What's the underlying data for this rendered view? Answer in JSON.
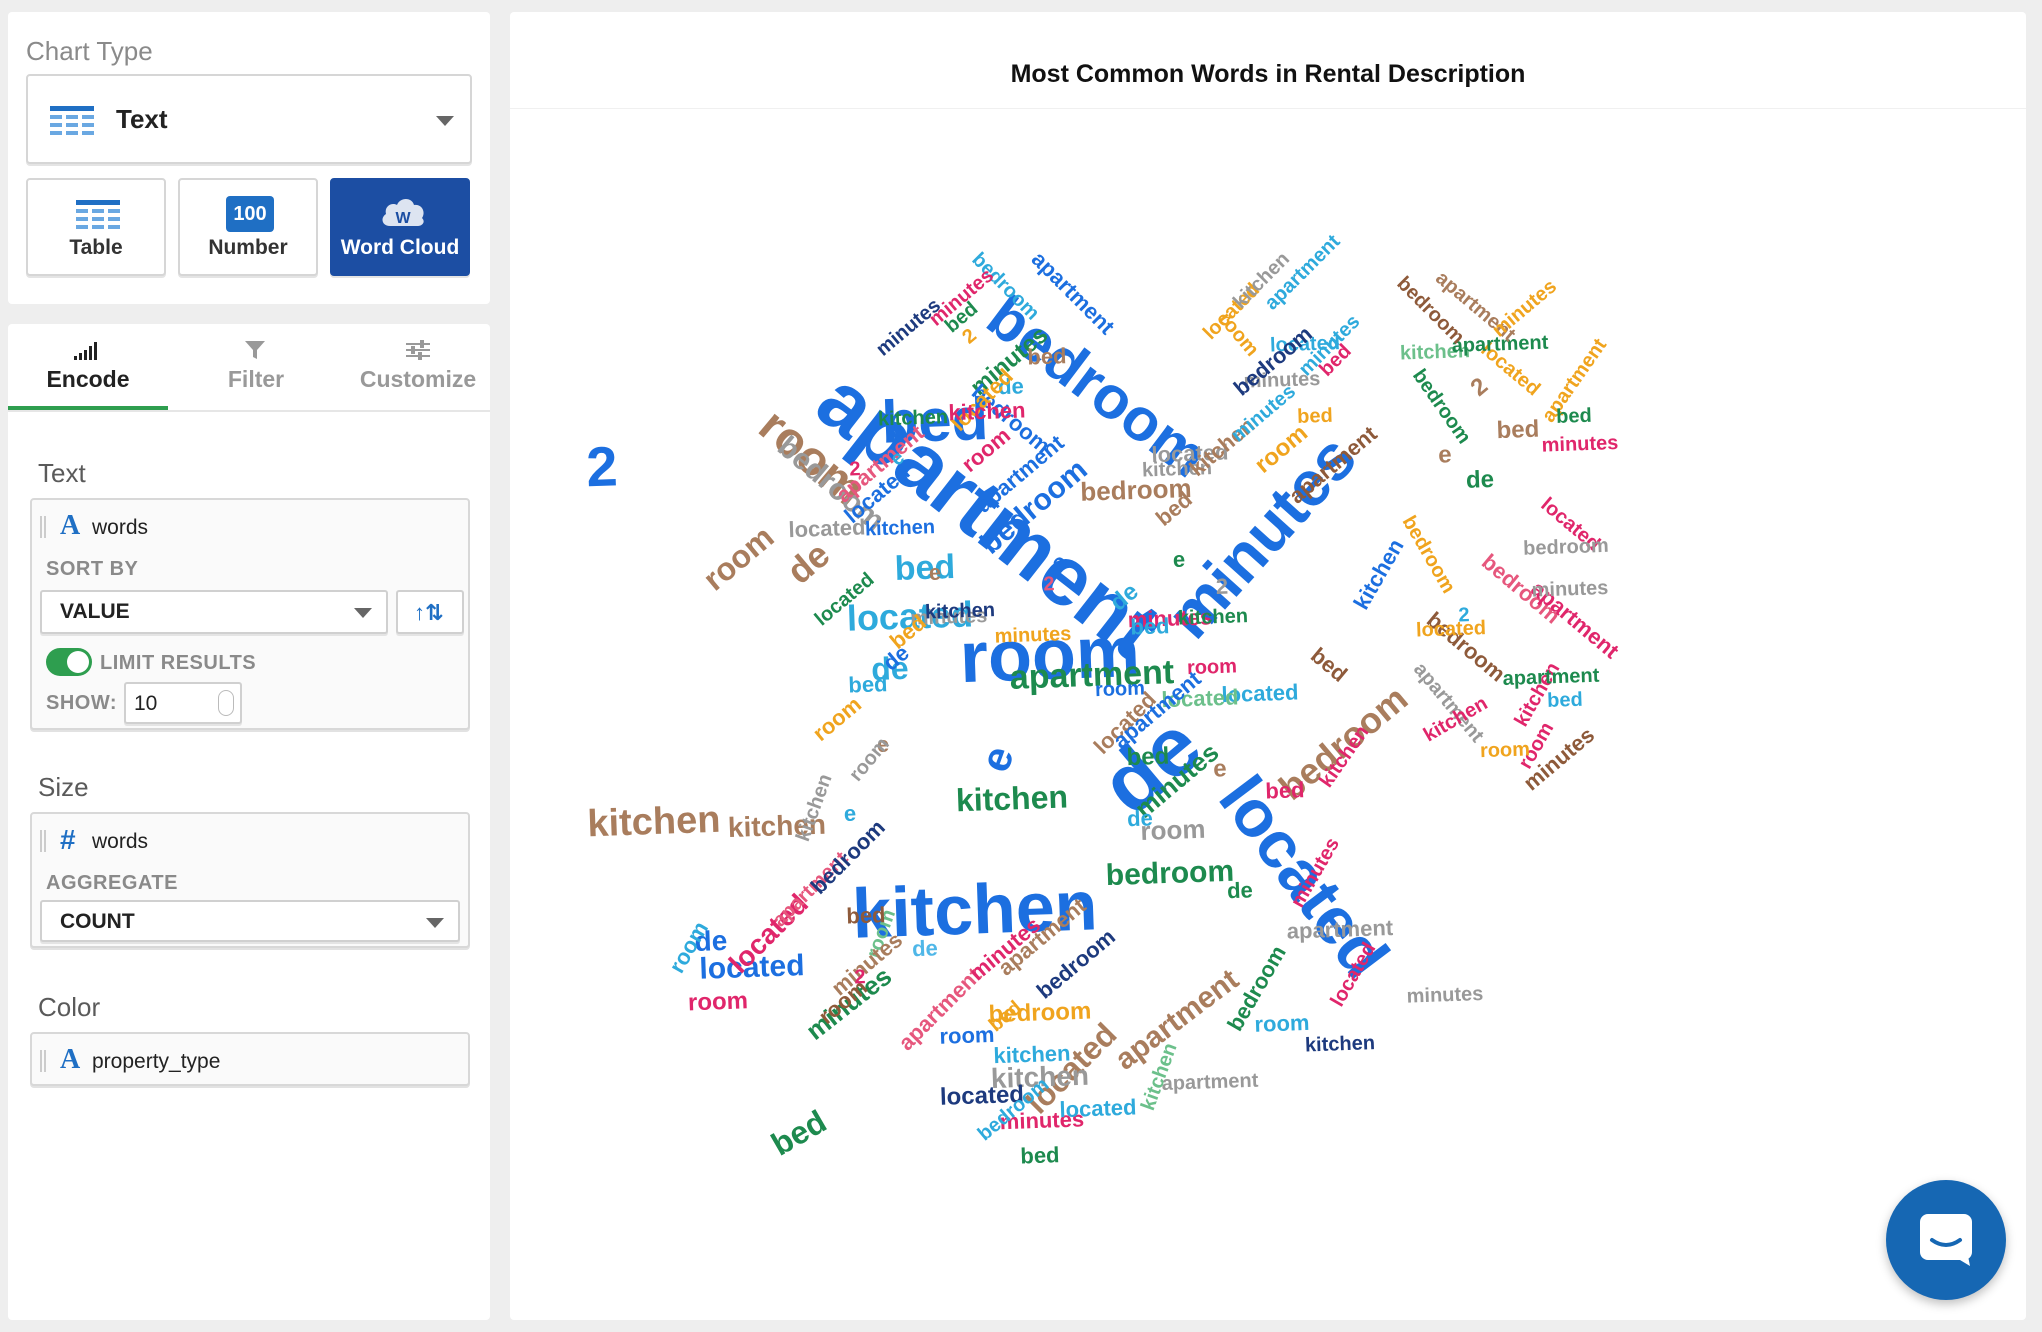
{
  "chart_type_panel": {
    "heading": "Chart Type",
    "selected_type": "Text",
    "buttons": {
      "table": "Table",
      "number": "Number",
      "number_icon_text": "100",
      "word_cloud": "Word Cloud",
      "word_cloud_icon_text": "W"
    },
    "active_button": "Word Cloud"
  },
  "tabs": {
    "encode": "Encode",
    "filter": "Filter",
    "customize": "Customize",
    "active": "Encode"
  },
  "encode": {
    "text": {
      "heading": "Text",
      "field_icon": "A",
      "field": "words",
      "sort_by_label": "SORT BY",
      "sort_by_value": "VALUE",
      "sort_direction_icon": "↑⇅",
      "limit_results_label": "LIMIT RESULTS",
      "limit_results_on": true,
      "show_label": "SHOW:",
      "show_value": "10"
    },
    "size": {
      "heading": "Size",
      "field_icon": "#",
      "field": "words",
      "aggregate_label": "AGGREGATE",
      "aggregate_value": "COUNT"
    },
    "color": {
      "heading": "Color",
      "field_icon": "A",
      "field": "property_type"
    }
  },
  "chart": {
    "title": "Most Common Words in Rental Description"
  },
  "icons": {
    "chart_type_select": "table-icon",
    "table": "table-icon",
    "number": "number-icon",
    "word_cloud": "cloud-icon",
    "encode": "bar-signal-icon",
    "filter": "funnel-icon",
    "customize": "sliders-icon",
    "chat": "chat-bubble-icon"
  },
  "colors": {
    "accent": "#1c4ea3",
    "tab_active": "#2e9e4f",
    "toggle_on": "#2e9e4f",
    "chat": "#1667b3"
  },
  "chart_data": {
    "type": "word_cloud",
    "title": "Most Common Words in Rental Description",
    "words": [
      "apartment",
      "bedroom",
      "room",
      "de",
      "kitchen",
      "located",
      "minutes",
      "bed",
      "e",
      "2"
    ],
    "color_field": "property_type",
    "palette": [
      "#1c6fe0",
      "#a97d5d",
      "#999999",
      "#1d8a4e",
      "#2eaadc",
      "#e0266b",
      "#f0a41e",
      "#6cc08b",
      "#8e5a3a",
      "#e6577d",
      "#1d3a7e",
      "#4fb7e8",
      "#50d070"
    ]
  }
}
